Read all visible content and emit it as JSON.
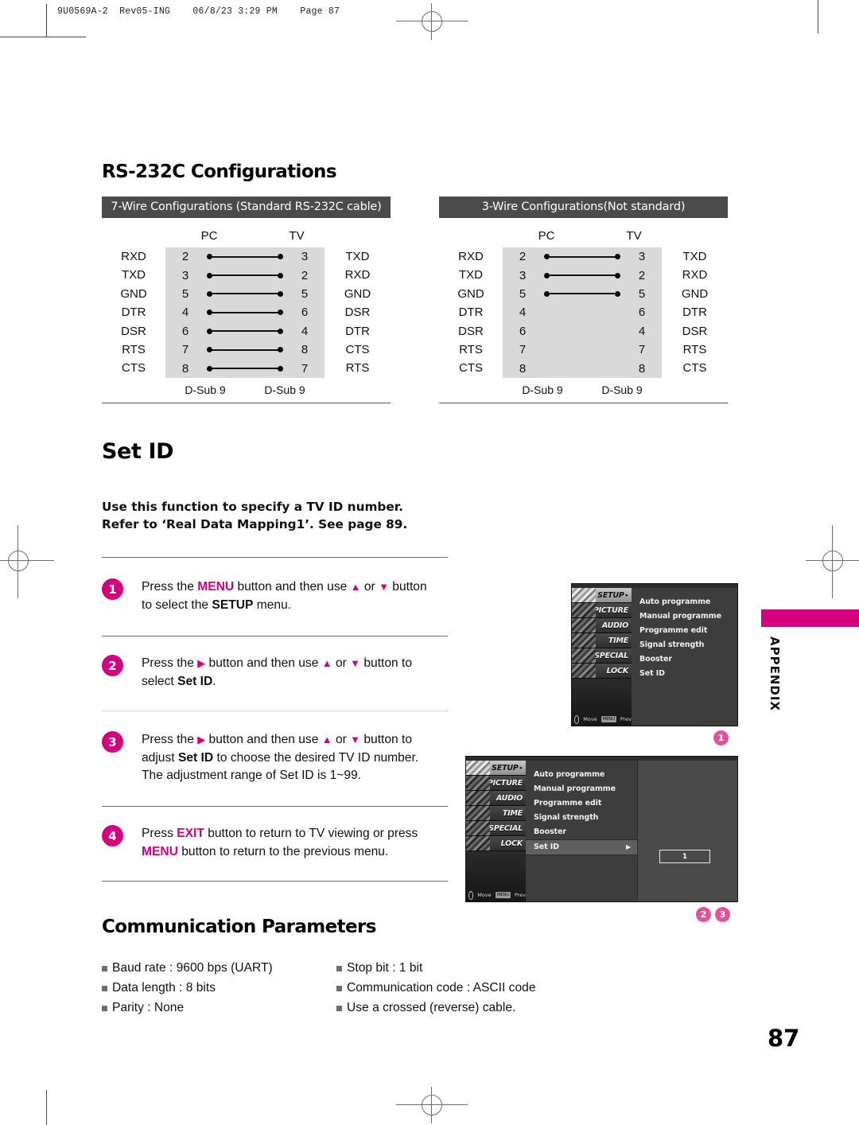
{
  "print_slug": "9U0569A-2  Rev05-ING    06/8/23 3:29 PM    Page 87",
  "sections": {
    "rs232c_title": "RS-232C Configurations",
    "setid_title": "Set ID",
    "comm_title": "Communication Parameters"
  },
  "wire_configs": [
    {
      "title": "7-Wire Configurations (Standard RS-232C cable)",
      "head_pc": "PC",
      "head_tv": "TV",
      "footer_left": "D-Sub 9",
      "footer_right": "D-Sub 9",
      "rows": [
        {
          "left_label": "RXD",
          "left_pin": "2",
          "right_pin": "3",
          "right_label": "TXD",
          "connected": true
        },
        {
          "left_label": "TXD",
          "left_pin": "3",
          "right_pin": "2",
          "right_label": "RXD",
          "connected": true
        },
        {
          "left_label": "GND",
          "left_pin": "5",
          "right_pin": "5",
          "right_label": "GND",
          "connected": true
        },
        {
          "left_label": "DTR",
          "left_pin": "4",
          "right_pin": "6",
          "right_label": "DSR",
          "connected": true
        },
        {
          "left_label": "DSR",
          "left_pin": "6",
          "right_pin": "4",
          "right_label": "DTR",
          "connected": true
        },
        {
          "left_label": "RTS",
          "left_pin": "7",
          "right_pin": "8",
          "right_label": "CTS",
          "connected": true
        },
        {
          "left_label": "CTS",
          "left_pin": "8",
          "right_pin": "7",
          "right_label": "RTS",
          "connected": true
        }
      ]
    },
    {
      "title": "3-Wire Configurations(Not standard)",
      "head_pc": "PC",
      "head_tv": "TV",
      "footer_left": "D-Sub 9",
      "footer_right": "D-Sub 9",
      "rows": [
        {
          "left_label": "RXD",
          "left_pin": "2",
          "right_pin": "3",
          "right_label": "TXD",
          "connected": true
        },
        {
          "left_label": "TXD",
          "left_pin": "3",
          "right_pin": "2",
          "right_label": "RXD",
          "connected": true
        },
        {
          "left_label": "GND",
          "left_pin": "5",
          "right_pin": "5",
          "right_label": "GND",
          "connected": true
        },
        {
          "left_label": "DTR",
          "left_pin": "4",
          "right_pin": "6",
          "right_label": "DTR",
          "connected": false
        },
        {
          "left_label": "DSR",
          "left_pin": "6",
          "right_pin": "4",
          "right_label": "DSR",
          "connected": false
        },
        {
          "left_label": "RTS",
          "left_pin": "7",
          "right_pin": "7",
          "right_label": "RTS",
          "connected": false
        },
        {
          "left_label": "CTS",
          "left_pin": "8",
          "right_pin": "8",
          "right_label": "CTS",
          "connected": false
        }
      ]
    }
  ],
  "setid": {
    "intro_line1": "Use this function to specify a TV ID number.",
    "intro_line2": "Refer to ‘Real Data Mapping1’. See page 89.",
    "steps": [
      {
        "number": "1",
        "segments": [
          {
            "t": "Press the ",
            "s": "n"
          },
          {
            "t": "MENU",
            "s": "m"
          },
          {
            "t": " button and then use ",
            "s": "n"
          },
          {
            "t": "▲",
            "s": "t"
          },
          {
            "t": " or ",
            "s": "n"
          },
          {
            "t": "▼",
            "s": "t"
          },
          {
            "t": " button",
            "s": "n"
          },
          {
            "t": "\n",
            "s": "br"
          },
          {
            "t": "to select the ",
            "s": "n"
          },
          {
            "t": "SETUP",
            "s": "b"
          },
          {
            "t": " menu.",
            "s": "n"
          }
        ]
      },
      {
        "number": "2",
        "segments": [
          {
            "t": "Press the ",
            "s": "n"
          },
          {
            "t": "▶",
            "s": "t"
          },
          {
            "t": " button and then use ",
            "s": "n"
          },
          {
            "t": "▲",
            "s": "t"
          },
          {
            "t": " or ",
            "s": "n"
          },
          {
            "t": "▼",
            "s": "t"
          },
          {
            "t": " button to",
            "s": "n"
          },
          {
            "t": "\n",
            "s": "br"
          },
          {
            "t": "select ",
            "s": "n"
          },
          {
            "t": "Set ID",
            "s": "b"
          },
          {
            "t": ".",
            "s": "n"
          }
        ]
      },
      {
        "number": "3",
        "segments": [
          {
            "t": "Press the ",
            "s": "n"
          },
          {
            "t": "▶",
            "s": "t"
          },
          {
            "t": " button and then use ",
            "s": "n"
          },
          {
            "t": "▲",
            "s": "t"
          },
          {
            "t": " or ",
            "s": "n"
          },
          {
            "t": "▼",
            "s": "t"
          },
          {
            "t": " button to",
            "s": "n"
          },
          {
            "t": "\n",
            "s": "br"
          },
          {
            "t": "adjust ",
            "s": "n"
          },
          {
            "t": "Set ID",
            "s": "b"
          },
          {
            "t": " to choose the desired TV ID number.",
            "s": "n"
          },
          {
            "t": "\n",
            "s": "br"
          },
          {
            "t": "The adjustment range of Set ID is 1~99.",
            "s": "n"
          }
        ]
      },
      {
        "number": "4",
        "segments": [
          {
            "t": "Press ",
            "s": "n"
          },
          {
            "t": "EXIT",
            "s": "m"
          },
          {
            "t": " button to return to TV viewing or press",
            "s": "n"
          },
          {
            "t": "\n",
            "s": "br"
          },
          {
            "t": "MENU",
            "s": "m"
          },
          {
            "t": " button to return to the previous menu.",
            "s": "n"
          }
        ]
      }
    ]
  },
  "osd": {
    "sidebar": [
      {
        "label": "SETUP",
        "selected": true,
        "arrow": "▸"
      },
      {
        "label": "PICTURE",
        "selected": false,
        "arrow": ""
      },
      {
        "label": "AUDIO",
        "selected": false,
        "arrow": ""
      },
      {
        "label": "TIME",
        "selected": false,
        "arrow": ""
      },
      {
        "label": "SPECIAL",
        "selected": false,
        "arrow": ""
      },
      {
        "label": "LOCK",
        "selected": false,
        "arrow": ""
      }
    ],
    "menu_items": [
      "Auto programme",
      "Manual programme",
      "Programme edit",
      "Signal strength",
      "Booster",
      "Set ID"
    ],
    "nav_move": "Move",
    "nav_prev": "Prev",
    "nav_prev_chip": "MENU",
    "highlight_item": "Set ID",
    "highlight_arrow": "▶",
    "value": "1",
    "markers_first": [
      "1"
    ],
    "markers_second": [
      "2",
      "3"
    ]
  },
  "appendix_tab": "APPENDIX",
  "comm_params": {
    "left": [
      "Baud rate : 9600 bps (UART)",
      "Data length : 8 bits",
      "Parity : None"
    ],
    "right": [
      "Stop bit : 1 bit",
      "Communication code : ASCII code",
      "Use a crossed (reverse) cable."
    ]
  },
  "page_number": "87",
  "colors": {
    "accent_magenta": "#d6007f",
    "marker_pink": "#e0529b",
    "band_gray": "#4b4b4b"
  }
}
